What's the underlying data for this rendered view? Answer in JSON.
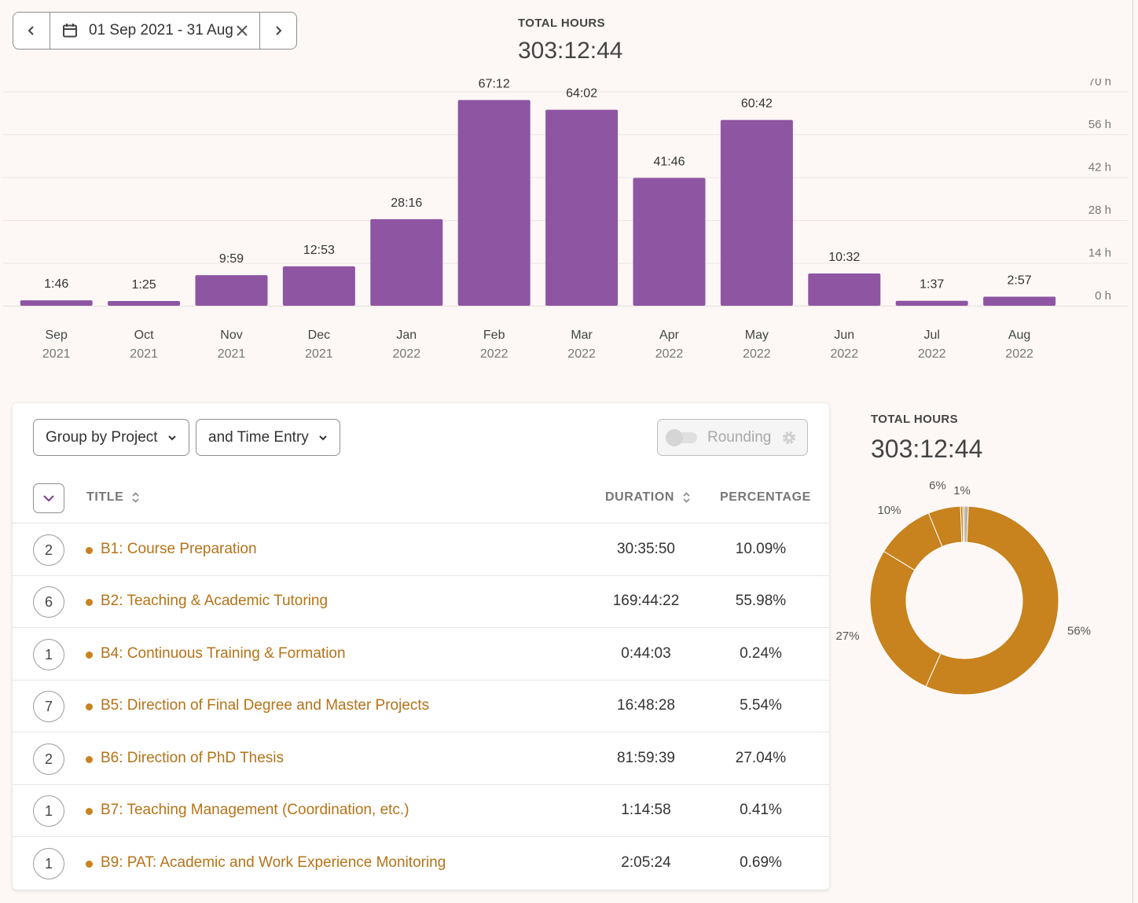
{
  "date_range": {
    "label": "01 Sep 2021 - 31 Aug",
    "prev_icon": "chevron-left-icon",
    "next_icon": "chevron-right-icon",
    "calendar_icon": "calendar-icon",
    "clear_icon": "close-icon"
  },
  "summary": {
    "label": "TOTAL HOURS",
    "value": "303:12:44"
  },
  "colors": {
    "bar": "#8e55a3",
    "donut_main": "#c8821e",
    "donut_small": "#b0b0b0",
    "title_text": "#b57318"
  },
  "chart_data": [
    {
      "type": "bar",
      "categories": [
        "Sep 2021",
        "Oct 2021",
        "Nov 2021",
        "Dec 2021",
        "Jan 2022",
        "Feb 2022",
        "Mar 2022",
        "Apr 2022",
        "May 2022",
        "Jun 2022",
        "Jul 2022",
        "Aug 2022"
      ],
      "category_lines": [
        [
          "Sep",
          "2021"
        ],
        [
          "Oct",
          "2021"
        ],
        [
          "Nov",
          "2021"
        ],
        [
          "Dec",
          "2021"
        ],
        [
          "Jan",
          "2022"
        ],
        [
          "Feb",
          "2022"
        ],
        [
          "Mar",
          "2022"
        ],
        [
          "Apr",
          "2022"
        ],
        [
          "May",
          "2022"
        ],
        [
          "Jun",
          "2022"
        ],
        [
          "Jul",
          "2022"
        ],
        [
          "Aug",
          "2022"
        ]
      ],
      "values": [
        1.767,
        1.417,
        9.983,
        12.883,
        28.267,
        67.2,
        64.033,
        41.767,
        60.7,
        10.533,
        1.617,
        2.95
      ],
      "data_labels": [
        "1:46",
        "1:25",
        "9:59",
        "12:53",
        "28:16",
        "67:12",
        "64:02",
        "41:46",
        "60:42",
        "10:32",
        "1:37",
        "2:57"
      ],
      "ylim": [
        0,
        70
      ],
      "yticks": [
        0,
        14,
        28,
        42,
        56,
        70
      ],
      "ytick_labels": [
        "0 h",
        "14 h",
        "28 h",
        "42 h",
        "56 h",
        "70 h"
      ],
      "grid": true,
      "axis_position": "right"
    },
    {
      "type": "pie",
      "style": "donut",
      "labels": [
        "B1: Course Preparation",
        "B2: Teaching & Academic Tutoring",
        "B4: Continuous Training & Formation",
        "B5: Direction of Final Degree and Master Projects",
        "B6: Direction of PhD Thesis",
        "B7: Teaching Management (Coordination, etc.)",
        "B9: PAT: Academic and Work Experience Monitoring"
      ],
      "values": [
        10.09,
        55.98,
        0.24,
        5.54,
        27.04,
        0.41,
        0.69
      ],
      "slice_labels": [
        "10%",
        "56%",
        "",
        "6%",
        "27%",
        "",
        "1%"
      ]
    }
  ],
  "controls": {
    "group_by": "Group by Project",
    "sub_group": "and Time Entry",
    "rounding": "Rounding"
  },
  "table": {
    "headers": {
      "title": "TITLE",
      "duration": "DURATION",
      "percentage": "PERCENTAGE"
    },
    "rows": [
      {
        "count": "2",
        "title": "B1: Course Preparation",
        "duration": "30:35:50",
        "percentage": "10.09%"
      },
      {
        "count": "6",
        "title": "B2: Teaching & Academic Tutoring",
        "duration": "169:44:22",
        "percentage": "55.98%"
      },
      {
        "count": "1",
        "title": "B4: Continuous Training & Formation",
        "duration": "0:44:03",
        "percentage": "0.24%"
      },
      {
        "count": "7",
        "title": "B5: Direction of Final Degree and Master Projects",
        "duration": "16:48:28",
        "percentage": "5.54%"
      },
      {
        "count": "2",
        "title": "B6: Direction of PhD Thesis",
        "duration": "81:59:39",
        "percentage": "27.04%"
      },
      {
        "count": "1",
        "title": "B7: Teaching Management (Coordination, etc.)",
        "duration": "1:14:58",
        "percentage": "0.41%"
      },
      {
        "count": "1",
        "title": "B9: PAT: Academic and Work Experience Monitoring",
        "duration": "2:05:24",
        "percentage": "0.69%"
      }
    ]
  }
}
